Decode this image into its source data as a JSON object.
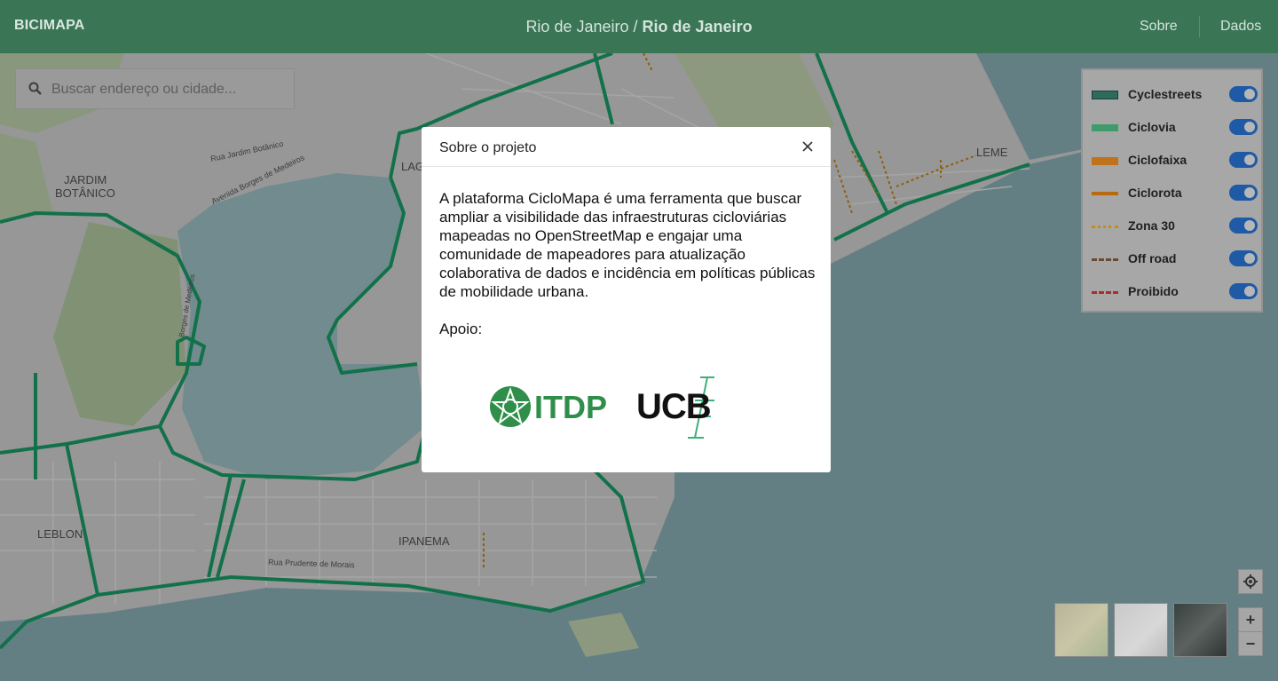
{
  "header": {
    "brand": "BICIMAPA",
    "location_city": "Rio de Janeiro",
    "location_separator": " / ",
    "location_state": "Rio de Janeiro",
    "nav": [
      {
        "label": "Sobre"
      },
      {
        "label": "Dados"
      }
    ]
  },
  "search": {
    "placeholder": "Buscar endereço ou cidade..."
  },
  "legend": {
    "items": [
      {
        "label": "Cyclestreets",
        "color": "#2d6b5c",
        "style": "solid-outline",
        "enabled": true
      },
      {
        "label": "Ciclovia",
        "color": "#3f9c6a",
        "style": "solid",
        "enabled": true
      },
      {
        "label": "Ciclofaixa",
        "color": "#c1721c",
        "style": "solid",
        "enabled": true
      },
      {
        "label": "Ciclorota",
        "color": "#b76a10",
        "style": "thin",
        "enabled": true
      },
      {
        "label": "Zona 30",
        "color": "#c88a10",
        "style": "dotted",
        "enabled": true
      },
      {
        "label": "Off road",
        "color": "#6b4a30",
        "style": "dashed",
        "enabled": true
      },
      {
        "label": "Proibido",
        "color": "#b02a2a",
        "style": "dashed",
        "enabled": true
      }
    ]
  },
  "map_labels": [
    {
      "text": "JARDIM"
    },
    {
      "text": "BOTÂNICO"
    },
    {
      "text": "LEBLON"
    },
    {
      "text": "IPANEMA"
    },
    {
      "text": "LEME"
    },
    {
      "text": "LAG"
    },
    {
      "text": "Rua Jardim Botânico"
    },
    {
      "text": "Avenida Borges de Medeiros"
    },
    {
      "text": "Rua Prudente de Morais"
    },
    {
      "text": "Borges de Medeiros"
    }
  ],
  "modal": {
    "title": "Sobre o projeto",
    "body": "A plataforma CicloMapa é uma ferramenta que buscar ampliar a visibilidade das infraestruturas cicloviárias mapeadas no OpenStreetMap e engajar uma comunidade de mapeadores para atualização colaborativa de dados e incidência em políticas públicas de mobilidade urbana.",
    "support_label": "Apoio:",
    "logos": [
      {
        "text": "ITDP",
        "color": "#2f8f4a"
      },
      {
        "text": "UCB",
        "color": "#111111"
      }
    ]
  },
  "map_styles": [
    {
      "name": "terrain-map-icon"
    },
    {
      "name": "light-map-icon"
    },
    {
      "name": "satellite-map-icon"
    }
  ],
  "controls": {
    "zoom_in": "+",
    "zoom_out": "−"
  },
  "colors": {
    "header": "#3a7556",
    "ciclovia": "#1aa36a",
    "water": "#8fb7bd"
  }
}
